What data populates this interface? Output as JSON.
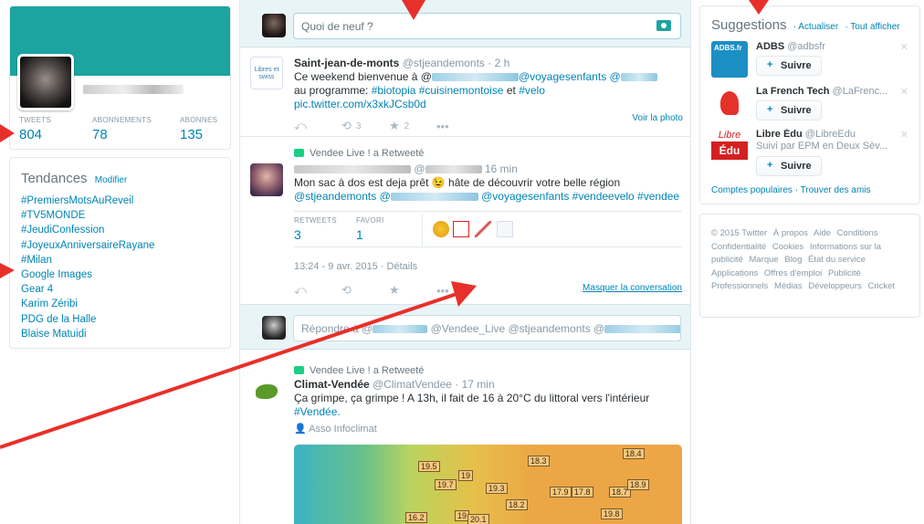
{
  "profile": {
    "stats": [
      {
        "label": "TWEETS",
        "value": "804"
      },
      {
        "label": "ABONNEMENTS",
        "value": "78"
      },
      {
        "label": "ABONNES",
        "value": "135"
      }
    ]
  },
  "trends": {
    "title": "Tendances",
    "modify": "Modifier",
    "items": [
      "#PremiersMotsAuReveil",
      "#TV5MONDE",
      "#JeudiConfession",
      "#JoyeuxAnniversaireRayane",
      "#Milan",
      "Google Images",
      "Gear 4",
      "Karim Zéribi",
      "PDG de la Halle",
      "Blaise Matuidi"
    ]
  },
  "compose": {
    "placeholder": "Quoi de neuf ?"
  },
  "tweet1": {
    "name": "Saint-jean-de-monts",
    "handle": "@stjeandemonts · 2 h",
    "text_a": "Ce weekend bienvenue à @",
    "mention": "@voyagesenfants @",
    "text_b": "au programme:",
    "tags": "#biotopia #cuisinemontoise",
    "and": "et",
    "tag2": "#velo",
    "link": "pic.twitter.com/x3xkJCsb0d",
    "rt_count": "3",
    "fav_count": "2",
    "see_photo": "Voir la photo",
    "avatar_text": "Libres et swiss"
  },
  "tweet2": {
    "rt_by": "Vendee Live ! a Retweeté",
    "handle": "@",
    "time": "16 min",
    "text": "Mon sac à dos est deja prêt 😉 hâte de découvrir votre belle région",
    "mentions_a": "@stjeandemonts @",
    "mentions_b": "@voyagesenfants #vendeevelo #vendee",
    "rt_label": "RETWEETS",
    "rt_value": "3",
    "fav_label": "FAVORI",
    "fav_value": "1",
    "date": "13:24 - 9 avr. 2015 · Détails",
    "hide": "Masquer la conversation"
  },
  "reply": {
    "text_a": "Répondre à @",
    "text_b": "@Vendee_Live @stjeandemonts @"
  },
  "tweet3": {
    "rt_by": "Vendee Live ! a Retweeté",
    "name": "Climat-Vendée",
    "handle": "@ClimatVendee · 17 min",
    "text": "Ça grimpe, ça grimpe ! A 13h, il fait de 16 à 20°C du littoral vers l'intérieur",
    "tag": "#Vendée.",
    "place": "Asso Infoclimat",
    "map_labels": [
      "18.3",
      "18.4",
      "19.5",
      "19",
      "19.7",
      "19.3",
      "18.2",
      "17.9",
      "17.8",
      "18.7",
      "18.9",
      "16.2",
      "19",
      "20.1",
      "19.8"
    ]
  },
  "suggestions": {
    "title": "Suggestions",
    "refresh": "· Actualiser",
    "all": "· Tout afficher",
    "items": [
      {
        "name": "ADBS",
        "handle": "@adbsfr",
        "follow": "Suivre",
        "logo": "ADBS.fr",
        "sub": ""
      },
      {
        "name": "La French Tech",
        "handle": "@LaFrenc...",
        "follow": "Suivre",
        "logo": "",
        "sub": ""
      },
      {
        "name": "Libre Édu",
        "handle": "@LibreEdu",
        "follow": "Suivre",
        "logo_a": "Libre",
        "logo_b": "Édu",
        "sub": "Suivi par EPM en Deux Sèv..."
      }
    ],
    "footer": "Comptes populaires · Trouver des amis"
  },
  "footer_links": [
    "© 2015 Twitter",
    "À propos",
    "Aide",
    "Conditions",
    "Confidentialité",
    "Cookies",
    "Informations sur la publicité",
    "Marque",
    "Blog",
    "État du service",
    "Applications",
    "Offres d'emploi",
    "Publicité",
    "Professionnels",
    "Médias",
    "Développeurs",
    "Cricket"
  ],
  "colors": {
    "accent": "#1ba4a0",
    "link": "#0084b4",
    "arrow": "#e8302a"
  }
}
